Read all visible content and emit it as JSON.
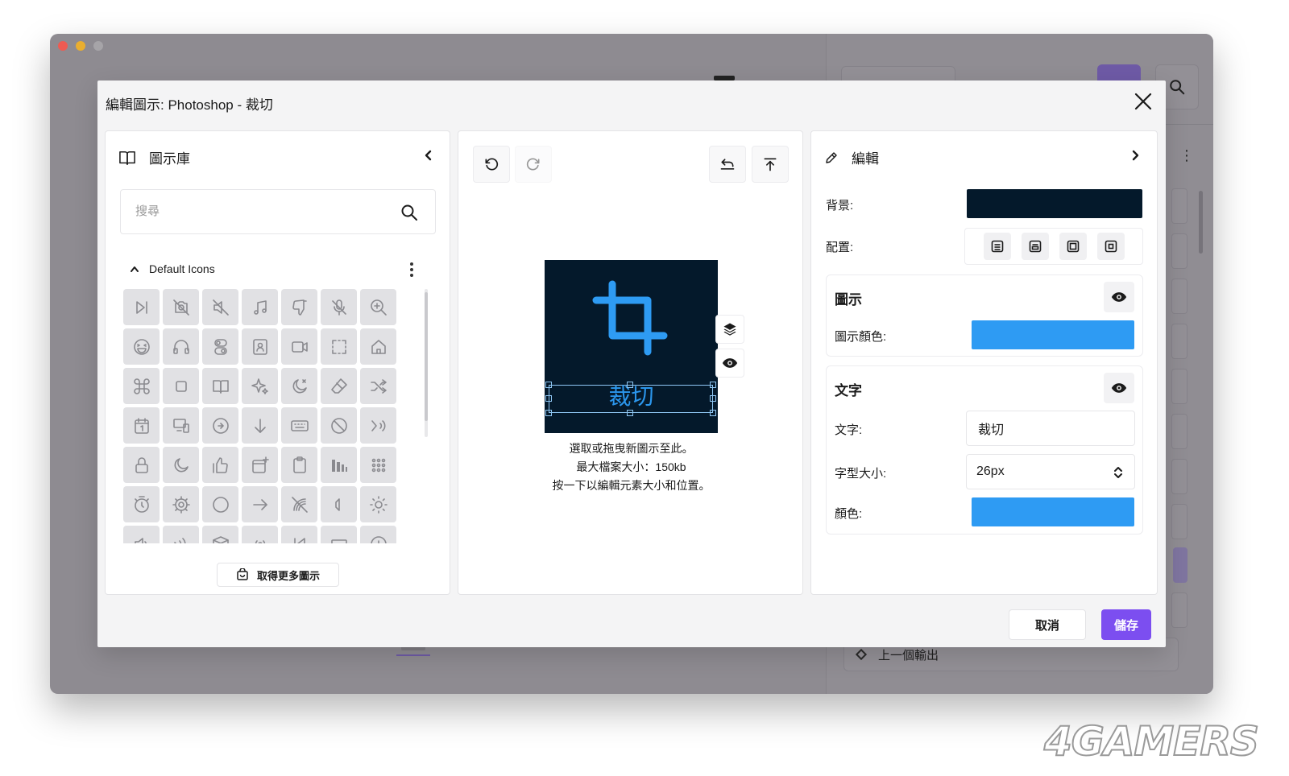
{
  "dialog": {
    "title": "編輯圖示: Photoshop - 裁切",
    "cancel_label": "取消",
    "save_label": "儲存"
  },
  "background_app": {
    "previous_output_label": "上一個輸出"
  },
  "library": {
    "title": "圖示庫",
    "search_placeholder": "搜尋",
    "group_title": "Default Icons",
    "get_more_label": "取得更多圖示",
    "icons": [
      "skip-forward-icon",
      "camera-off-icon",
      "mute-icon",
      "music-icon",
      "thumbs-down-icon",
      "mic-off-icon",
      "zoom-in-icon",
      "laugh-emoji-icon",
      "headphones-icon",
      "toggles-icon",
      "contact-card-icon",
      "video-camera-icon",
      "selection-icon",
      "home-icon",
      "command-icon",
      "square-icon",
      "book-icon",
      "sparkles-icon",
      "moon-star-icon",
      "eraser-icon",
      "shuffle-icon",
      "calendar-1-icon",
      "devices-icon",
      "play-circle-icon",
      "arrow-down-icon",
      "keyboard-icon",
      "ban-icon",
      "voice-icon",
      "lock-icon",
      "moon-icon",
      "thumbs-up-icon",
      "calendar-plus-icon",
      "clipboard-icon",
      "equalizer-icon",
      "grid-icon",
      "timer-icon",
      "gear-icon",
      "circle-icon",
      "arrow-right-icon",
      "signal-off-icon",
      "volume-low-icon",
      "sun-icon",
      "volume-icon",
      "volume-waves-icon",
      "box-icon",
      "broadcast-icon",
      "rewind-icon",
      "rectangle-icon",
      "add-circle-icon"
    ]
  },
  "preview": {
    "tile_text": "裁切",
    "tile_background": "#04192b",
    "icon_color": "#2e9bf3",
    "hint_line1": "選取或拖曳新圖示至此。",
    "hint_line2": "最大檔案大小：150kb",
    "hint_line3": "按一下以編輯元素大小和位置。"
  },
  "editor": {
    "title": "編輯",
    "background_label": "背景:",
    "background_color": "#04192b",
    "layout_label": "配置:",
    "icon_section_title": "圖示",
    "icon_color_label": "圖示顏色:",
    "icon_color": "#2e9bf3",
    "text_section_title": "文字",
    "text_label": "文字:",
    "text_value": "裁切",
    "font_size_label": "字型大小:",
    "font_size_value": "26px",
    "color_label": "顏色:",
    "text_color": "#2e9bf3"
  },
  "watermark": "4GAMERS"
}
